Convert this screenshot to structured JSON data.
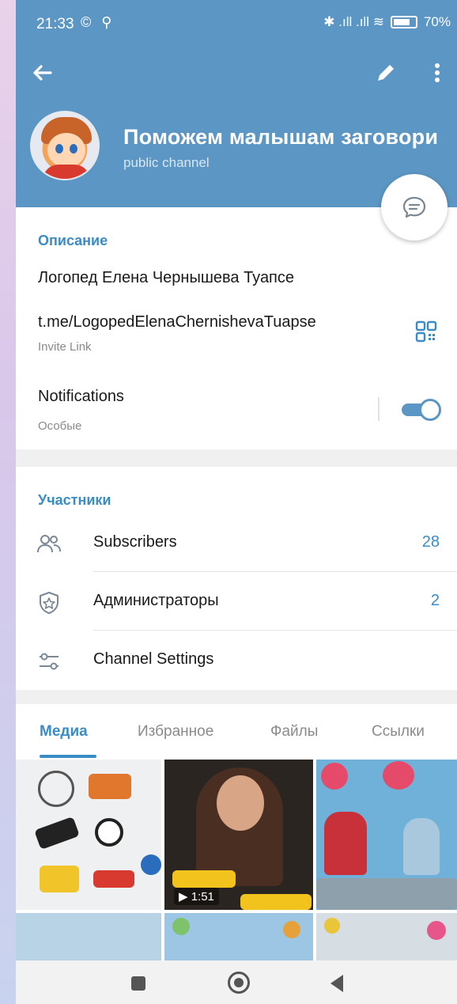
{
  "status_bar": {
    "time": "21:33",
    "left_icons": "© ⚲",
    "signal": "✱ .ıll .ıll ≋",
    "battery": "70%"
  },
  "header": {
    "title": "Поможем малышам заговори",
    "subtitle": "public channel",
    "color": "#5b96c4"
  },
  "info": {
    "section_title": "Описание",
    "description": "Логопед Елена Чернышева Туапсе",
    "link": "t.me/LogopedElenaChernishevaTuapse",
    "link_caption": "Invite Link",
    "notifications_label": "Notifications",
    "notifications_value": "Особые",
    "notifications_on": true
  },
  "members": {
    "section_title": "Участники",
    "rows": [
      {
        "label": "Subscribers",
        "value": "28",
        "icon": "people-icon"
      },
      {
        "label": "Администраторы",
        "value": "2",
        "icon": "shield-star-icon"
      },
      {
        "label": "Channel Settings",
        "value": "",
        "icon": "sliders-icon"
      }
    ]
  },
  "tabs": [
    {
      "label": "Медиа",
      "active": true
    },
    {
      "label": "Избранное",
      "active": false
    },
    {
      "label": "Файлы",
      "active": false
    },
    {
      "label": "Ссылки",
      "active": false
    }
  ],
  "media": {
    "video_duration": "▶ 1:51"
  },
  "accent": "#3a8cc7"
}
